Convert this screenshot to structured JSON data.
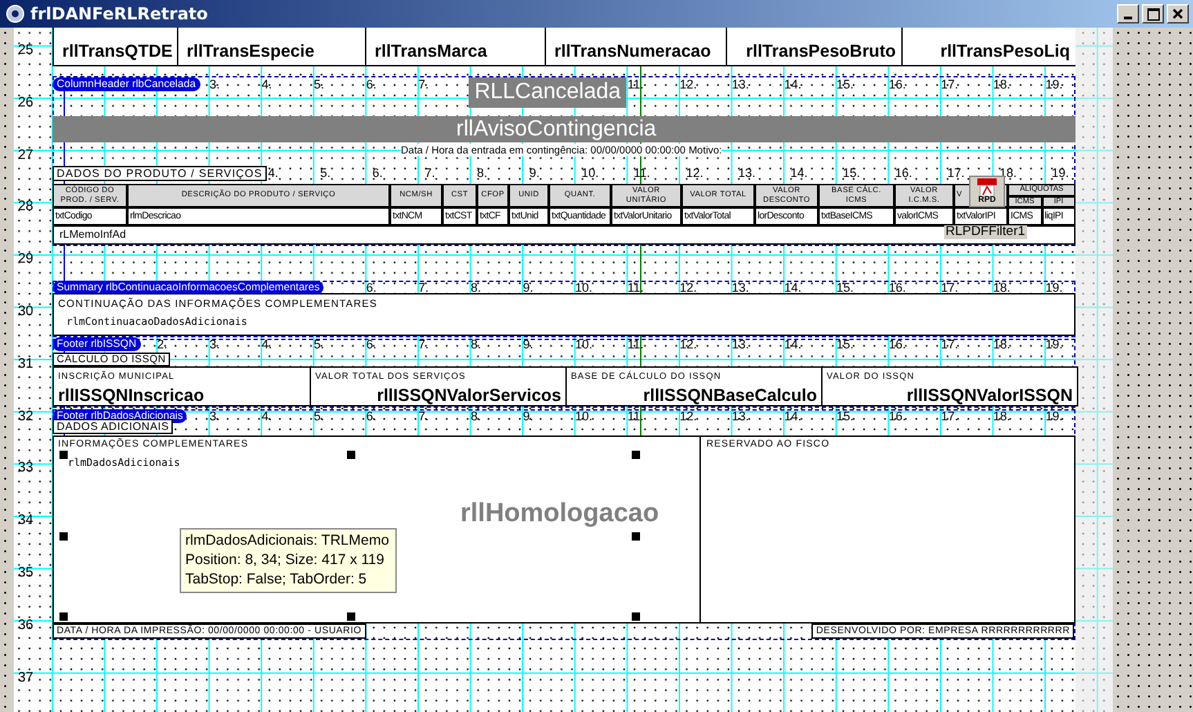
{
  "window": {
    "title": "frlDANFeRLRetrato"
  },
  "row_numbers": [
    "25",
    "26",
    "27",
    "28",
    "29",
    "30",
    "31",
    "32",
    "33",
    "34",
    "35",
    "36",
    "37"
  ],
  "transport": [
    "rllTransQTDE",
    "rllTransEspecie",
    "rllTransMarca",
    "rllTransNumeracao",
    "rllTransPesoBruto",
    "rllTransPesoLiq"
  ],
  "column_header": {
    "label": "ColumnHeader rlbCancelada",
    "marks_before": [
      "3.",
      "4.",
      "5.",
      "6.",
      "7."
    ],
    "caption": "RLLCancelada",
    "marks_after": [
      "11.",
      "12.",
      "13.",
      "14.",
      "15.",
      "16.",
      "17.",
      "18.",
      "19."
    ]
  },
  "notice": "rllAvisoContingencia",
  "contingency_line": "Data / Hora da entrada em contingência: 00/00/0000 00:00:00  Motivo:",
  "products": {
    "title": "DADOS DO PRODUTO / SERVIÇOS",
    "marks": [
      "4.",
      "5.",
      "6.",
      "7.",
      "8.",
      "9.",
      "10.",
      "11.",
      "12.",
      "13.",
      "14.",
      "15.",
      "16.",
      "17.",
      "18.",
      "19."
    ],
    "columns": [
      {
        "label": "CÓDIGO DO PROD. / SERV.",
        "field": "txtCodigo"
      },
      {
        "label": "DESCRIÇÃO DO PRODUTO / SERVIÇO",
        "field": "rlmDescricao"
      },
      {
        "label": "NCM/SH",
        "field": "txtNCM"
      },
      {
        "label": "CST",
        "field": "txtCST"
      },
      {
        "label": "CFOP",
        "field": "txtCF"
      },
      {
        "label": "UNID",
        "field": "txtUnid"
      },
      {
        "label": "QUANT.",
        "field": "txtQuantidade"
      },
      {
        "label": "VALOR UNITÁRIO",
        "field": "txtValorUnitario"
      },
      {
        "label": "VALOR TOTAL",
        "field": "txtValorTotal"
      },
      {
        "label": "VALOR DESCONTO",
        "field": "lorDesconto"
      },
      {
        "label": "BASE CÁLC. ICMS",
        "field": "txtBaseICMS"
      },
      {
        "label": "VALOR I.C.M.S.",
        "field": "valorICMS"
      },
      {
        "label": "V",
        "field": "txtValorIPI"
      }
    ],
    "rates": {
      "label": "ALÍQUOTAS",
      "sub": [
        {
          "label": "ICMS",
          "field": "ICMS"
        },
        {
          "label": "IPI",
          "field": "liqIPI"
        }
      ]
    },
    "memo": "rLMemoInfAd"
  },
  "pdf_filter": {
    "icon_label": "RPD",
    "name": "RLPDFFilter1"
  },
  "summary": {
    "label": "Summary rlbContinuacaoInformacoesComplementares",
    "marks": [
      "6.",
      "7.",
      "8.",
      "9.",
      "10.",
      "11.",
      "12.",
      "13.",
      "14.",
      "15.",
      "16.",
      "17.",
      "18.",
      "19."
    ],
    "title": "CONTINUAÇÃO DAS INFORMAÇÕES COMPLEMENTARES",
    "memo": "rlmContinuacaoDadosAdicionais"
  },
  "issqn": {
    "label": "Footer rlbISSQN",
    "marks": [
      "2.",
      "3.",
      "4.",
      "5.",
      "6.",
      "7.",
      "8.",
      "9.",
      "10.",
      "11.",
      "12.",
      "13.",
      "14.",
      "15.",
      "16.",
      "17.",
      "18.",
      "19."
    ],
    "title": "CÁLCULO DO ISSQN",
    "fields": [
      {
        "label": "INSCRIÇÃO MUNICIPAL",
        "value": "rllISSQNInscricao"
      },
      {
        "label": "VALOR TOTAL DOS SERVIÇOS",
        "value": "rllISSQNValorServicos"
      },
      {
        "label": "BASE DE CÁLCULO DO ISSQN",
        "value": "rllISSQNBaseCalculo"
      },
      {
        "label": "VALOR DO ISSQN",
        "value": "rllISSQNValorISSQN"
      }
    ]
  },
  "additional": {
    "label": "Footer rlbDadosAdicionais",
    "marks": [
      "3.",
      "4.",
      "5.",
      "6.",
      "7.",
      "8.",
      "9.",
      "10.",
      "11.",
      "12.",
      "13.",
      "14.",
      "15.",
      "16.",
      "17.",
      "18.",
      "19."
    ],
    "title": "DADOS ADICIONAIS",
    "info_label": "INFORMAÇÕES COMPLEMENTARES",
    "memo": "rlmDadosAdicionais",
    "memo_selected": true,
    "homologation": "rllHomologacao",
    "fisco_label": "RESERVADO AO FISCO",
    "print_line": "DATA / HORA DA IMPRESSÃO: 00/00/0000 00:00:00 - USUARIO",
    "developer": "DESENVOLVIDO POR: EMPRESA RRRRRRRRRRRR"
  },
  "tooltip": [
    "rlmDadosAdicionais: TRLMemo",
    "Position: 8, 34; Size: 417 x 119",
    "TabStop: False; TabOrder: 5"
  ]
}
